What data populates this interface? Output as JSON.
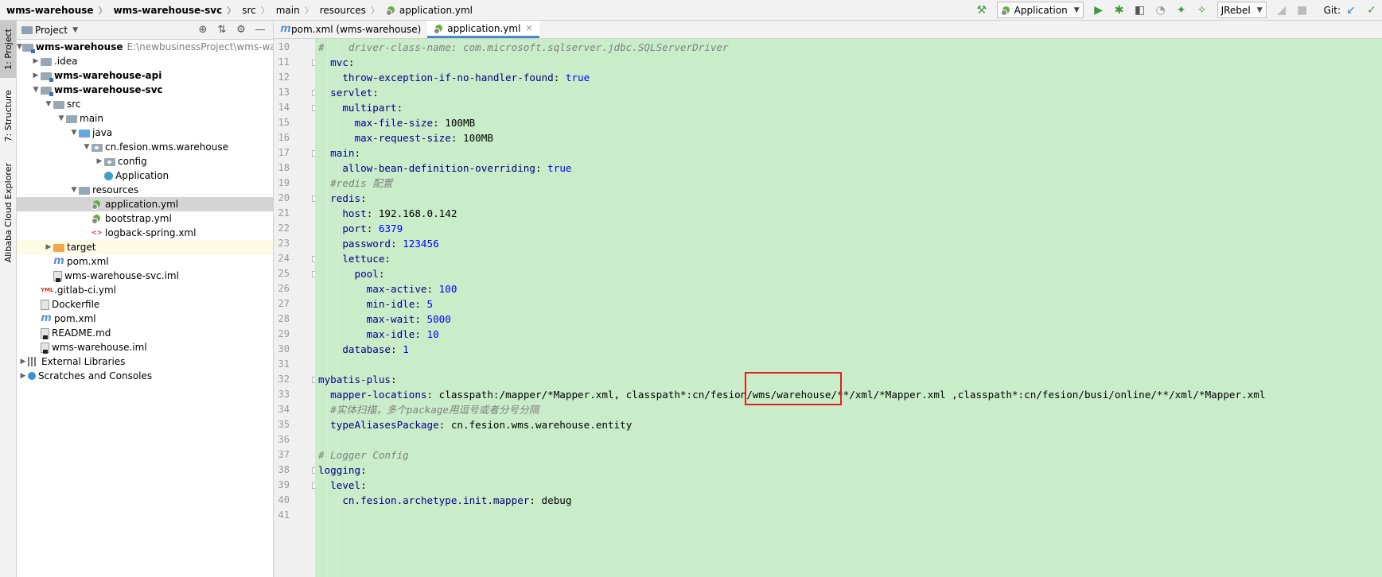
{
  "breadcrumb": {
    "items": [
      "wms-warehouse",
      "wms-warehouse-svc",
      "src",
      "main",
      "resources"
    ],
    "file": "application.yml"
  },
  "toolbar": {
    "run_config": "Application",
    "jrebel": "JRebel",
    "git_label": "Git:"
  },
  "toolstrip": {
    "tabs": [
      "1: Project",
      "7: Structure",
      "Alibaba Cloud Explorer"
    ]
  },
  "project_panel": {
    "title": "Project",
    "tree": [
      {
        "label": "wms-warehouse",
        "path": "E:\\newbusinessProject\\wms-warehouse",
        "depth": 0,
        "expanded": true,
        "icon": "module-folder",
        "bold": true
      },
      {
        "label": ".idea",
        "depth": 1,
        "expanded": false,
        "icon": "folder"
      },
      {
        "label": "wms-warehouse-api",
        "depth": 1,
        "expanded": false,
        "icon": "module-folder",
        "bold": true
      },
      {
        "label": "wms-warehouse-svc",
        "depth": 1,
        "expanded": true,
        "icon": "module-folder",
        "bold": true
      },
      {
        "label": "src",
        "depth": 2,
        "expanded": true,
        "icon": "folder"
      },
      {
        "label": "main",
        "depth": 3,
        "expanded": true,
        "icon": "folder"
      },
      {
        "label": "java",
        "depth": 4,
        "expanded": true,
        "icon": "source-folder"
      },
      {
        "label": "cn.fesion.wms.warehouse",
        "depth": 5,
        "expanded": true,
        "icon": "package"
      },
      {
        "label": "config",
        "depth": 6,
        "expanded": false,
        "icon": "package"
      },
      {
        "label": "Application",
        "depth": 6,
        "icon": "class"
      },
      {
        "label": "resources",
        "depth": 4,
        "expanded": true,
        "icon": "folder"
      },
      {
        "label": "application.yml",
        "depth": 5,
        "icon": "yml",
        "selected": true
      },
      {
        "label": "bootstrap.yml",
        "depth": 5,
        "icon": "yml"
      },
      {
        "label": "logback-spring.xml",
        "depth": 5,
        "icon": "xml"
      },
      {
        "label": "target",
        "depth": 2,
        "expanded": false,
        "icon": "excluded-folder",
        "highlight": true
      },
      {
        "label": "pom.xml",
        "depth": 2,
        "icon": "maven"
      },
      {
        "label": "wms-warehouse-svc.iml",
        "depth": 2,
        "icon": "iml"
      },
      {
        "label": ".gitlab-ci.yml",
        "depth": 1,
        "icon": "yml-file"
      },
      {
        "label": "Dockerfile",
        "depth": 1,
        "icon": "docker"
      },
      {
        "label": "pom.xml",
        "depth": 1,
        "icon": "maven"
      },
      {
        "label": "README.md",
        "depth": 1,
        "icon": "md"
      },
      {
        "label": "wms-warehouse.iml",
        "depth": 1,
        "icon": "iml"
      },
      {
        "label": "External Libraries",
        "depth": 0,
        "expanded": false,
        "icon": "libraries"
      },
      {
        "label": "Scratches and Consoles",
        "depth": 0,
        "expanded": false,
        "icon": "scratches"
      }
    ]
  },
  "editor": {
    "tabs": [
      {
        "label": "pom.xml (wms-warehouse)",
        "icon": "maven",
        "active": false
      },
      {
        "label": "application.yml",
        "icon": "yml",
        "active": true
      }
    ],
    "lines": [
      {
        "num": "10",
        "text": "#    driver-class-name: com.microsoft.sqlserver.jdbc.SQLServerDriver"
      },
      {
        "num": "11",
        "text": "  mvc:"
      },
      {
        "num": "12",
        "text": "    throw-exception-if-no-handler-found: true"
      },
      {
        "num": "13",
        "text": "  servlet:"
      },
      {
        "num": "14",
        "text": "    multipart:"
      },
      {
        "num": "15",
        "text": "      max-file-size: 100MB"
      },
      {
        "num": "16",
        "text": "      max-request-size: 100MB"
      },
      {
        "num": "17",
        "text": "  main:"
      },
      {
        "num": "18",
        "text": "    allow-bean-definition-overriding: true"
      },
      {
        "num": "19",
        "text": "  #redis 配置"
      },
      {
        "num": "20",
        "text": "  redis:"
      },
      {
        "num": "21",
        "text": "    host: 192.168.0.142"
      },
      {
        "num": "22",
        "text": "    port: 6379"
      },
      {
        "num": "23",
        "text": "    password: 123456"
      },
      {
        "num": "24",
        "text": "    lettuce:"
      },
      {
        "num": "25",
        "text": "      pool:"
      },
      {
        "num": "26",
        "text": "        max-active: 100"
      },
      {
        "num": "27",
        "text": "        min-idle: 5"
      },
      {
        "num": "28",
        "text": "        max-wait: 5000"
      },
      {
        "num": "29",
        "text": "        max-idle: 10"
      },
      {
        "num": "30",
        "text": "    database: 1"
      },
      {
        "num": "31",
        "text": ""
      },
      {
        "num": "32",
        "text": "mybatis-plus:"
      },
      {
        "num": "33",
        "text": "  mapper-locations: classpath:/mapper/*Mapper.xml, classpath*:cn/fesion/wms/warehouse/**/xml/*Mapper.xml ,classpath*:cn/fesion/busi/online/**/xml/*Mapper.xml"
      },
      {
        "num": "34",
        "text": "  #实体扫描，多个package用逗号或者分号分隔"
      },
      {
        "num": "35",
        "text": "  typeAliasesPackage: cn.fesion.wms.warehouse.entity"
      },
      {
        "num": "36",
        "text": ""
      },
      {
        "num": "37",
        "text": "# Logger Config"
      },
      {
        "num": "38",
        "text": "logging:"
      },
      {
        "num": "39",
        "text": "  level:"
      },
      {
        "num": "40",
        "text": "    cn.fesion.archetype.init.mapper: debug"
      },
      {
        "num": "41",
        "text": ""
      }
    ],
    "highlight_text": "/wms/warehouse/",
    "colors": {
      "editor_bg": "#c9ecc9",
      "key": "#000080",
      "comment": "#808080",
      "number": "#0000ff",
      "annotation": "#e02020"
    }
  }
}
